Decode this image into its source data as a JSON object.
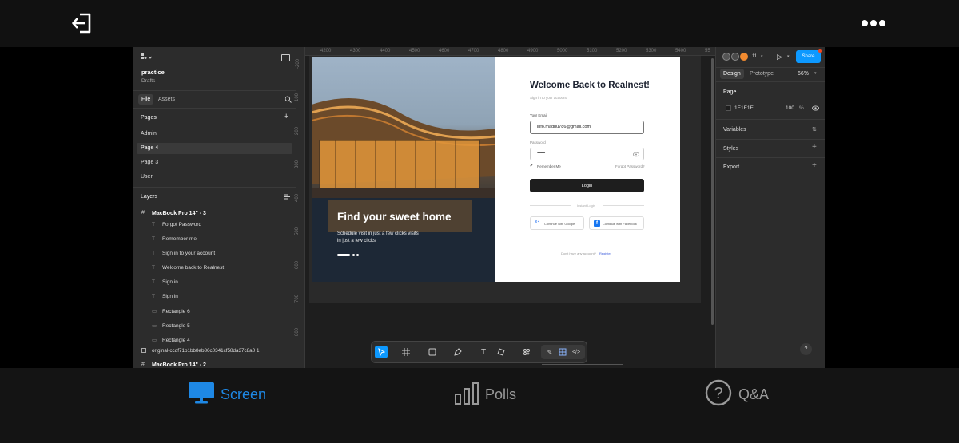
{
  "figma": {
    "file_name": "practice",
    "file_location": "Drafts",
    "tabs": [
      "File",
      "Assets"
    ],
    "pages_label": "Pages",
    "pages": [
      "Admin",
      "Page 4",
      "Page 3",
      "User"
    ],
    "layers_label": "Layers",
    "layers_root": "MacBook Pro 14\" - 3",
    "layers": [
      {
        "icon": "text",
        "name": "Forgot Password"
      },
      {
        "icon": "text",
        "name": "Remember me"
      },
      {
        "icon": "text",
        "name": "Sign in to your account"
      },
      {
        "icon": "text",
        "name": "Welcome back to Realnest"
      },
      {
        "icon": "text",
        "name": "Sign in"
      },
      {
        "icon": "text",
        "name": "Sign in"
      },
      {
        "icon": "rect",
        "name": "Rectangle 6"
      },
      {
        "icon": "rect",
        "name": "Rectangle 5"
      },
      {
        "icon": "rect",
        "name": "Rectangle 4"
      }
    ],
    "layers_image": "original-ccdf71b1bb8eb86c0341cf58da37c8a0 1",
    "layers_next_root": "MacBook Pro 14\" - 2",
    "ruler_top": [
      "4200",
      "4300",
      "4400",
      "4500",
      "4600",
      "4700",
      "4800",
      "4900",
      "5000",
      "5100",
      "5200",
      "5300",
      "5400",
      "55"
    ],
    "ruler_left": [
      "-200",
      "100",
      "200",
      "300",
      "400",
      "500",
      "600",
      "700",
      "800"
    ],
    "right_panel": {
      "user_count": "11",
      "share_label": "Share",
      "design_tab": "Design",
      "prototype_tab": "Prototype",
      "zoom": "66%",
      "page_section": "Page",
      "page_color": "1E1E1E",
      "page_opacity": "100",
      "percent": "%",
      "variables": "Variables",
      "styles": "Styles",
      "export": "Export",
      "help": "?"
    }
  },
  "design": {
    "hero_title": "Find your sweet home",
    "hero_sub": "Schedule visit in just a few clicks visits in just a few clicks",
    "welcome": "Welcome Back to Realnest!",
    "signin_sub": "Sign in to your account",
    "email_label": "Your Email",
    "email_value": "info.madhu786@gmail.com",
    "password_label": "Password",
    "password_value": "••••••••••",
    "remember": "Remember Me",
    "forgot": "Forgot Password?",
    "login_button": "Login",
    "divider": "Instant Login",
    "google_button": "Continue with Google",
    "facebook_button": "Continue with Facebook",
    "no_account": "Don't have any account?",
    "register": "Register"
  },
  "bottom_tabs": {
    "screen": "Screen",
    "polls": "Polls",
    "qa": "Q&A"
  },
  "colors": {
    "accent": "#1e88e5",
    "share_button": "#0d99ff",
    "inactive_tab": "#999999"
  }
}
